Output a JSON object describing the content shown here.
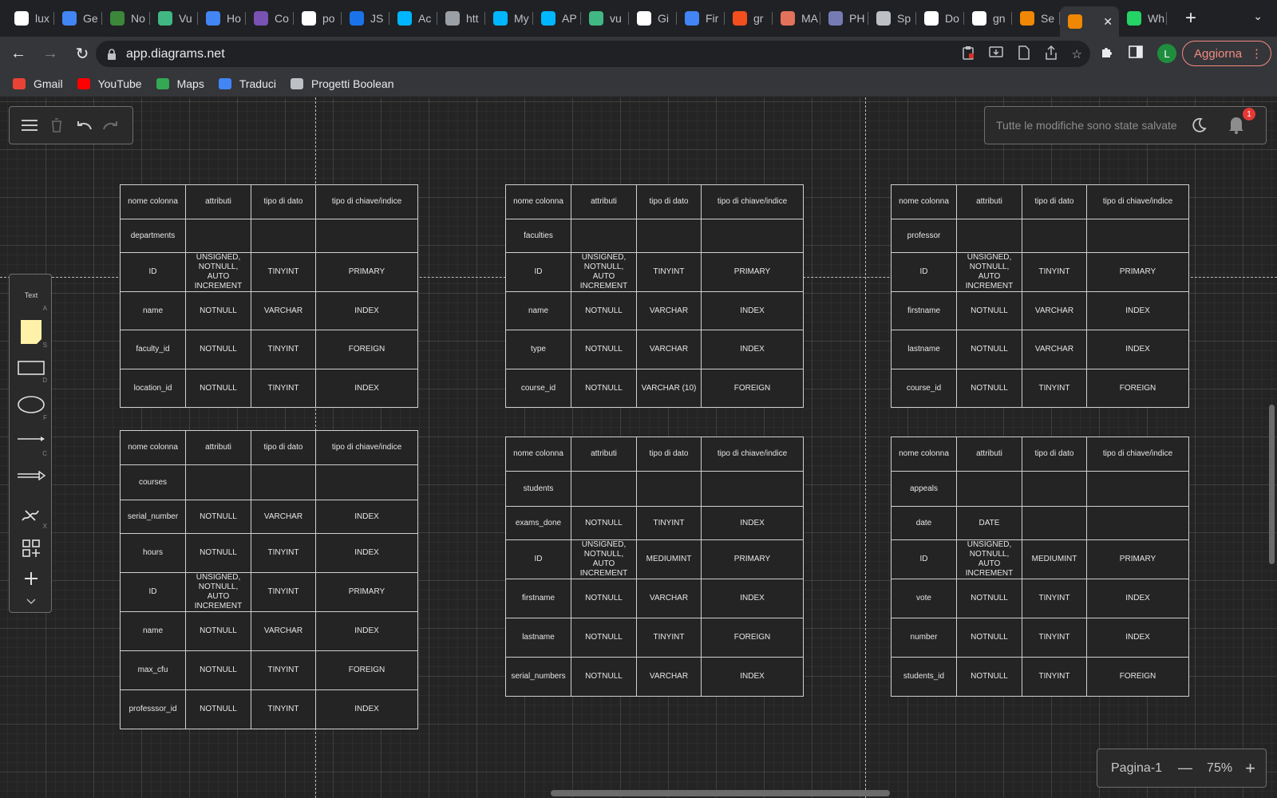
{
  "browser": {
    "tabs": [
      {
        "label": "lux",
        "icon": "google-icon",
        "color": "#ffffff"
      },
      {
        "label": "Ge",
        "icon": "doc-icon",
        "color": "#4285f4"
      },
      {
        "label": "No",
        "icon": "node-icon",
        "color": "#3c873a"
      },
      {
        "label": "Vu",
        "icon": "vue-icon",
        "color": "#41b883"
      },
      {
        "label": "Ho",
        "icon": "globe-icon",
        "color": "#4285f4"
      },
      {
        "label": "Co",
        "icon": "bootstrap-icon",
        "color": "#7952b3"
      },
      {
        "label": "po",
        "icon": "google-icon",
        "color": "#ffffff"
      },
      {
        "label": "JS",
        "icon": "check-icon",
        "color": "#1a73e8"
      },
      {
        "label": "Ac",
        "icon": "dash-icon",
        "color": "#00b7ff"
      },
      {
        "label": "htt",
        "icon": "globe-icon",
        "color": "#9aa0a6"
      },
      {
        "label": "My",
        "icon": "dash-icon",
        "color": "#00b7ff"
      },
      {
        "label": "AP",
        "icon": "dash-icon",
        "color": "#00b7ff"
      },
      {
        "label": "vu",
        "icon": "vue-icon",
        "color": "#41b883"
      },
      {
        "label": "Gi",
        "icon": "github-icon",
        "color": "#ffffff"
      },
      {
        "label": "Fir",
        "icon": "flag-icon",
        "color": "#4285f4"
      },
      {
        "label": "gr",
        "icon": "figma-icon",
        "color": "#f24e1e"
      },
      {
        "label": "MA",
        "icon": "m-icon",
        "color": "#e2725b"
      },
      {
        "label": "PH",
        "icon": "php-icon",
        "color": "#777bb3"
      },
      {
        "label": "Sp",
        "icon": "skull-icon",
        "color": "#bdc1c6"
      },
      {
        "label": "Do",
        "icon": "google-icon",
        "color": "#ffffff"
      },
      {
        "label": "gn",
        "icon": "google-icon",
        "color": "#ffffff"
      },
      {
        "label": "Se",
        "icon": "drawio-icon",
        "color": "#f08705"
      }
    ],
    "active_tab": {
      "label": "",
      "icon": "drawio-icon",
      "color": "#f08705"
    },
    "after_active": [
      {
        "label": "Wh",
        "icon": "whatsapp-icon",
        "color": "#25d366"
      }
    ],
    "url": "app.diagrams.net",
    "profile_initial": "L",
    "update_label": "Aggiorna",
    "bookmarks": [
      {
        "label": "Gmail",
        "icon": "gmail-icon",
        "color": "#ea4335"
      },
      {
        "label": "YouTube",
        "icon": "youtube-icon",
        "color": "#ff0000"
      },
      {
        "label": "Maps",
        "icon": "maps-icon",
        "color": "#34a853"
      },
      {
        "label": "Traduci",
        "icon": "translate-icon",
        "color": "#4285f4"
      },
      {
        "label": "Progetti Boolean",
        "icon": "boolean-icon",
        "color": "#bdc1c6"
      }
    ]
  },
  "app": {
    "status_text": "Tutte le modifiche sono state salvate",
    "notification_count": "1",
    "shapes_panel": {
      "text_label": "Text",
      "text_key": "A",
      "keys": [
        "S",
        "D",
        "F",
        "C",
        "X"
      ]
    },
    "page_label": "Pagina-1",
    "zoom": "75%"
  },
  "header_row": [
    "nome colonna",
    "attributi",
    "tipo di dato",
    "tipo di chiave/indice"
  ],
  "tables": [
    {
      "id": "departments",
      "rows": [
        [
          "departments",
          "",
          "",
          ""
        ],
        [
          "ID",
          "UNSIGNED, NOTNULL, AUTO INCREMENT",
          "TINYINT",
          "PRIMARY"
        ],
        [
          "name",
          "NOTNULL",
          "VARCHAR",
          "INDEX"
        ],
        [
          "faculty_id",
          "NOTNULL",
          "TINYINT",
          "FOREIGN"
        ],
        [
          "location_id",
          "NOTNULL",
          "TINYINT",
          "INDEX"
        ]
      ]
    },
    {
      "id": "faculties",
      "rows": [
        [
          "faculties",
          "",
          "",
          ""
        ],
        [
          "ID",
          "UNSIGNED, NOTNULL, AUTO INCREMENT",
          "TINYINT",
          "PRIMARY"
        ],
        [
          "name",
          "NOTNULL",
          "VARCHAR",
          "INDEX"
        ],
        [
          "type",
          "NOTNULL",
          "VARCHAR",
          "INDEX"
        ],
        [
          "course_id",
          "NOTNULL",
          "VARCHAR (10)",
          "FOREIGN"
        ]
      ]
    },
    {
      "id": "professor",
      "rows": [
        [
          "professor",
          "",
          "",
          ""
        ],
        [
          "ID",
          "UNSIGNED, NOTNULL, AUTO INCREMENT",
          "TINYINT",
          "PRIMARY"
        ],
        [
          "firstname",
          "NOTNULL",
          "VARCHAR",
          "INDEX"
        ],
        [
          "lastname",
          "NOTNULL",
          "VARCHAR",
          "INDEX"
        ],
        [
          "course_id",
          "NOTNULL",
          "TINYINT",
          "FOREIGN"
        ]
      ]
    },
    {
      "id": "courses",
      "rows": [
        [
          "courses",
          "",
          "",
          ""
        ],
        [
          "serial_number",
          "NOTNULL",
          "VARCHAR",
          "INDEX"
        ],
        [
          "hours",
          "NOTNULL",
          "TINYINT",
          "INDEX"
        ],
        [
          "ID",
          "UNSIGNED, NOTNULL, AUTO INCREMENT",
          "TINYINT",
          "PRIMARY"
        ],
        [
          "name",
          "NOTNULL",
          "VARCHAR",
          "INDEX"
        ],
        [
          "max_cfu",
          "NOTNULL",
          "TINYINT",
          "FOREIGN"
        ],
        [
          "professsor_id",
          "NOTNULL",
          "TINYINT",
          "INDEX"
        ]
      ]
    },
    {
      "id": "students",
      "rows": [
        [
          "students",
          "",
          "",
          ""
        ],
        [
          "exams_done",
          "NOTNULL",
          "TINYINT",
          "INDEX"
        ],
        [
          "ID",
          "UNSIGNED, NOTNULL, AUTO INCREMENT",
          "MEDIUMINT",
          "PRIMARY"
        ],
        [
          "firstname",
          "NOTNULL",
          "VARCHAR",
          "INDEX"
        ],
        [
          "lastname",
          "NOTNULL",
          "TINYINT",
          "FOREIGN"
        ],
        [
          "serial_numbers",
          "NOTNULL",
          "VARCHAR",
          "INDEX"
        ]
      ]
    },
    {
      "id": "appeals",
      "rows": [
        [
          "appeals",
          "",
          "",
          ""
        ],
        [
          "date",
          "DATE",
          "",
          ""
        ],
        [
          "ID",
          "UNSIGNED, NOTNULL, AUTO INCREMENT",
          "MEDIUMINT",
          "PRIMARY"
        ],
        [
          "vote",
          "NOTNULL",
          "TINYINT",
          "INDEX"
        ],
        [
          "number",
          "NOTNULL",
          "TINYINT",
          "INDEX"
        ],
        [
          "students_id",
          "NOTNULL",
          "TINYINT",
          "FOREIGN"
        ]
      ]
    }
  ]
}
